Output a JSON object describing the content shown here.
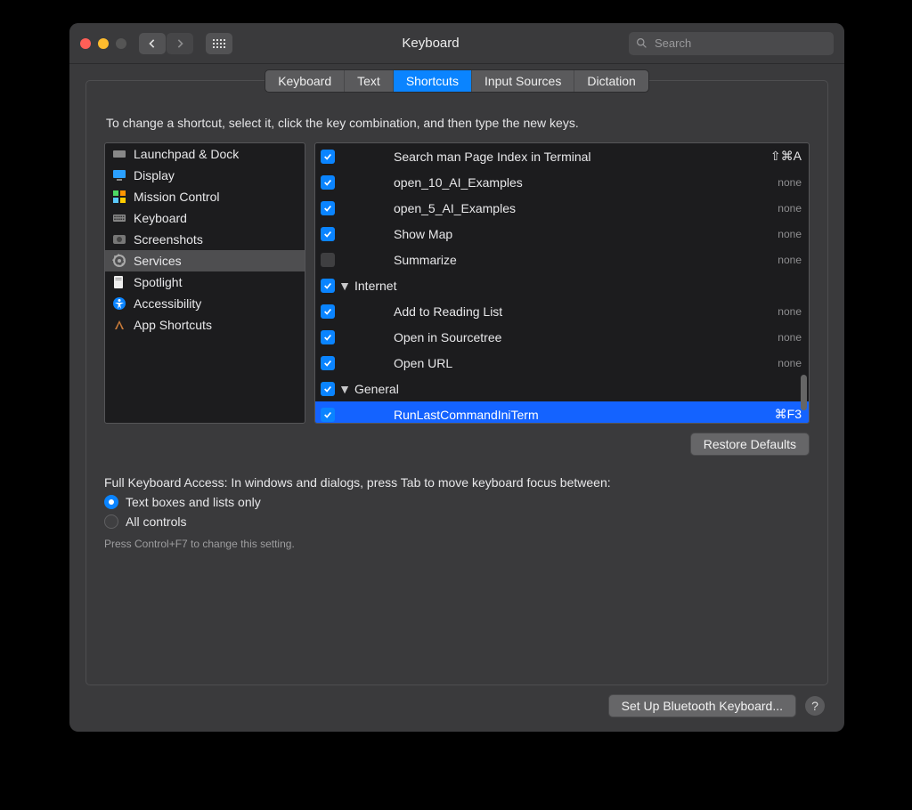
{
  "header": {
    "title": "Keyboard",
    "search_placeholder": "Search"
  },
  "tabs": [
    {
      "label": "Keyboard",
      "active": false
    },
    {
      "label": "Text",
      "active": false
    },
    {
      "label": "Shortcuts",
      "active": true
    },
    {
      "label": "Input Sources",
      "active": false
    },
    {
      "label": "Dictation",
      "active": false
    }
  ],
  "instruction": "To change a shortcut, select it, click the key combination, and then type the new keys.",
  "sidebar": {
    "items": [
      {
        "label": "Launchpad & Dock",
        "icon": "launchpad",
        "selected": false
      },
      {
        "label": "Display",
        "icon": "display",
        "selected": false
      },
      {
        "label": "Mission Control",
        "icon": "mission",
        "selected": false
      },
      {
        "label": "Keyboard",
        "icon": "keyboard",
        "selected": false
      },
      {
        "label": "Screenshots",
        "icon": "screenshots",
        "selected": false
      },
      {
        "label": "Services",
        "icon": "services",
        "selected": true
      },
      {
        "label": "Spotlight",
        "icon": "spotlight",
        "selected": false
      },
      {
        "label": "Accessibility",
        "icon": "accessibility",
        "selected": false
      },
      {
        "label": "App Shortcuts",
        "icon": "appshortcuts",
        "selected": false
      }
    ]
  },
  "services": {
    "rows": [
      {
        "checked": true,
        "group": false,
        "indent": 2,
        "label": "Search man Page Index in Terminal",
        "shortcut": "⇧⌘A",
        "selected": false
      },
      {
        "checked": true,
        "group": false,
        "indent": 2,
        "label": "open_10_AI_Examples",
        "shortcut": "none",
        "selected": false
      },
      {
        "checked": true,
        "group": false,
        "indent": 2,
        "label": "open_5_AI_Examples",
        "shortcut": "none",
        "selected": false
      },
      {
        "checked": true,
        "group": false,
        "indent": 2,
        "label": "Show Map",
        "shortcut": "none",
        "selected": false
      },
      {
        "checked": false,
        "group": false,
        "indent": 2,
        "label": "Summarize",
        "shortcut": "none",
        "selected": false
      },
      {
        "checked": true,
        "group": true,
        "indent": 0,
        "label": "Internet",
        "shortcut": "",
        "selected": false
      },
      {
        "checked": true,
        "group": false,
        "indent": 2,
        "label": "Add to Reading List",
        "shortcut": "none",
        "selected": false
      },
      {
        "checked": true,
        "group": false,
        "indent": 2,
        "label": "Open in Sourcetree",
        "shortcut": "none",
        "selected": false
      },
      {
        "checked": true,
        "group": false,
        "indent": 2,
        "label": "Open URL",
        "shortcut": "none",
        "selected": false
      },
      {
        "checked": true,
        "group": true,
        "indent": 0,
        "label": "General",
        "shortcut": "",
        "selected": false
      },
      {
        "checked": true,
        "group": false,
        "indent": 2,
        "label": "RunLastCommandIniTerm",
        "shortcut": "⌘F3",
        "selected": true
      }
    ]
  },
  "restore_label": "Restore Defaults",
  "fka": {
    "text": "Full Keyboard Access: In windows and dialogs, press Tab to move keyboard focus between:",
    "options": [
      {
        "label": "Text boxes and lists only",
        "selected": true
      },
      {
        "label": "All controls",
        "selected": false
      }
    ],
    "hint": "Press Control+F7 to change this setting."
  },
  "bluetooth_label": "Set Up Bluetooth Keyboard...",
  "help_label": "?"
}
